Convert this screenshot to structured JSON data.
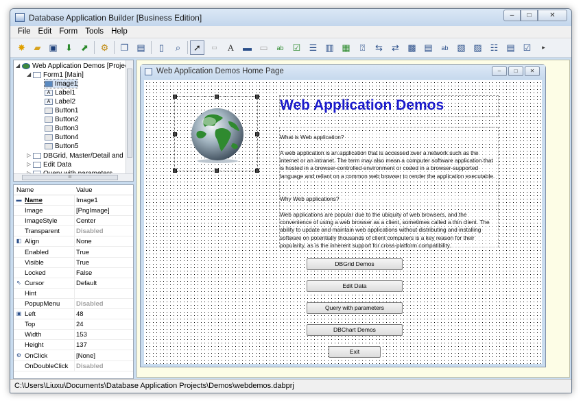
{
  "window": {
    "title": "Database Application Builder [Business Edition]",
    "min": "–",
    "max": "□",
    "close": "✕"
  },
  "menu": [
    "File",
    "Edit",
    "Form",
    "Tools",
    "Help"
  ],
  "tree": {
    "root": "Web Application Demos [Project",
    "form": "Form1 [Main]",
    "children": [
      "Image1",
      "Label1",
      "Label2",
      "Button1",
      "Button2",
      "Button3",
      "Button4",
      "Button5"
    ],
    "collapsed": [
      "DBGrid, Master/Detail and S",
      "Edit Data",
      "Query with parameters"
    ],
    "scroll_label": "III"
  },
  "properties": {
    "header": {
      "name": "Name",
      "value": "Value"
    },
    "rows": [
      {
        "name": "Name",
        "value": "Image1",
        "bold": true,
        "icon": "image-icon"
      },
      {
        "name": "Image",
        "value": "[PngImage]"
      },
      {
        "name": "ImageStyle",
        "value": "Center"
      },
      {
        "name": "Transparent",
        "value": "Disabled",
        "disabled": true
      },
      {
        "name": "Align",
        "value": "None",
        "icon": "align-icon"
      },
      {
        "name": "Enabled",
        "value": "True"
      },
      {
        "name": "Visible",
        "value": "True"
      },
      {
        "name": "Locked",
        "value": "False"
      },
      {
        "name": "Cursor",
        "value": "Default",
        "icon": "cursor-icon"
      },
      {
        "name": "Hint",
        "value": ""
      },
      {
        "name": "PopupMenu",
        "value": "Disabled",
        "disabled": true
      },
      {
        "name": "Left",
        "value": "48",
        "icon": "position-icon"
      },
      {
        "name": "Top",
        "value": "24"
      },
      {
        "name": "Width",
        "value": "153"
      },
      {
        "name": "Height",
        "value": "137"
      },
      {
        "name": "OnClick",
        "value": "[None]",
        "icon": "event-icon"
      },
      {
        "name": "OnDoubleClick",
        "value": "Disabled",
        "disabled": true
      }
    ]
  },
  "status": "C:\\Users\\Liuxu\\Documents\\Database Application Projects\\Demos\\webdemos.dabprj",
  "form": {
    "title": "Web Application Demos Home Page",
    "heading": "Web Application Demos",
    "paragraphs": [
      "What is Web application?",
      "A web application is an application that is accessed over a network such as the internet or an intranet. The term may also mean a computer software application that is hosted in a browser-controlled environment or coded in a browser-supported language and reliant on a common web browser to render the application executable.",
      "Why Web applications?",
      "Web applications are popular due to the ubiquity of web browsers, and the convenience of using a web browser as a client, sometimes called a thin client. The ability to update and maintain web applications without distributing and installing software on potentially thousands of client computers is a key reason for their popularity, as is the inherent support for cross-platform compatibility."
    ],
    "buttons": [
      "DBGrid Demos",
      "Edit Data",
      "Query with parameters",
      "DBChart Demos",
      "Exit"
    ]
  }
}
